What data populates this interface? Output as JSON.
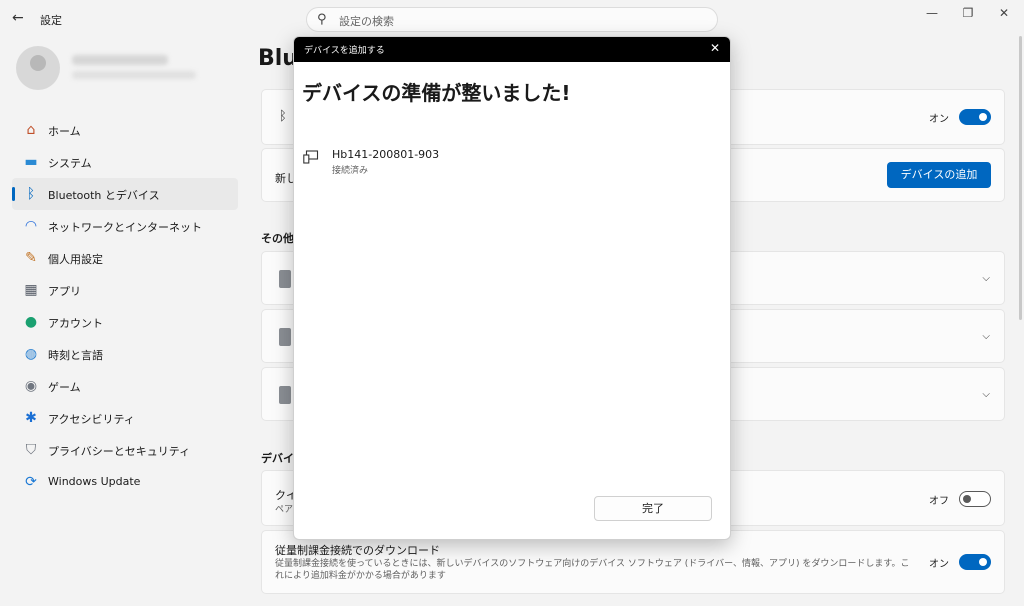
{
  "window": {
    "app_title": "設定",
    "search_placeholder": "設定の検索",
    "controls": {
      "minimize": "—",
      "maximize": "❐",
      "close": "✕"
    }
  },
  "sidebar": {
    "items": [
      {
        "label": "ホーム",
        "icon": "home-icon",
        "glyph": "⌂",
        "color": "#c0502a"
      },
      {
        "label": "システム",
        "icon": "system-icon",
        "glyph": "▬",
        "color": "#2a8ad4"
      },
      {
        "label": "Bluetooth とデバイス",
        "icon": "bluetooth-icon",
        "glyph": "ᛒ",
        "color": "#0067c0",
        "active": true
      },
      {
        "label": "ネットワークとインターネット",
        "icon": "wifi-icon",
        "glyph": "◠",
        "color": "#2a6fdb"
      },
      {
        "label": "個人用設定",
        "icon": "brush-icon",
        "glyph": "✎",
        "color": "#c07020"
      },
      {
        "label": "アプリ",
        "icon": "apps-icon",
        "glyph": "▦",
        "color": "#555b66"
      },
      {
        "label": "アカウント",
        "icon": "account-icon",
        "glyph": "●",
        "color": "#1aa070"
      },
      {
        "label": "時刻と言語",
        "icon": "globe-icon",
        "glyph": "◍",
        "color": "#2a80d0"
      },
      {
        "label": "ゲーム",
        "icon": "gamepad-icon",
        "glyph": "◉",
        "color": "#707680"
      },
      {
        "label": "アクセシビリティ",
        "icon": "accessibility-icon",
        "glyph": "✱",
        "color": "#1a6fd4"
      },
      {
        "label": "プライバシーとセキュリティ",
        "icon": "shield-icon",
        "glyph": "⛉",
        "color": "#6a707a"
      },
      {
        "label": "Windows Update",
        "icon": "update-icon",
        "glyph": "⟳",
        "color": "#1a78d4"
      }
    ]
  },
  "main": {
    "title_partial": "Blu",
    "bluetooth_row": {
      "toggle_label": "オン",
      "state": "on"
    },
    "add_device_row": {
      "label_partial": "新し",
      "button": "デバイスの追加"
    },
    "other_devices_heading_partial": "その他の",
    "device_settings_heading_partial": "デバイス",
    "swift_pair_row": {
      "label_partial": "クイ",
      "sub_partial": "ペア",
      "toggle_label": "オフ",
      "state": "off"
    },
    "metered_row": {
      "title": "従量制課金接続でのダウンロード",
      "desc": "従量制課金接続を使っているときには、新しいデバイスのソフトウェア向けのデバイス ソフトウェア (ドライバー、情報、アプリ) をダウンロードします。これにより追加料金がかかる場合があります",
      "toggle_label": "オン",
      "state": "on"
    }
  },
  "dialog": {
    "title": "デバイスを追加する",
    "heading": "デバイスの準備が整いました!",
    "device": {
      "name": "Hb141-200801-903",
      "status": "接続済み",
      "icon": "device-icon"
    },
    "done_button": "完了"
  }
}
